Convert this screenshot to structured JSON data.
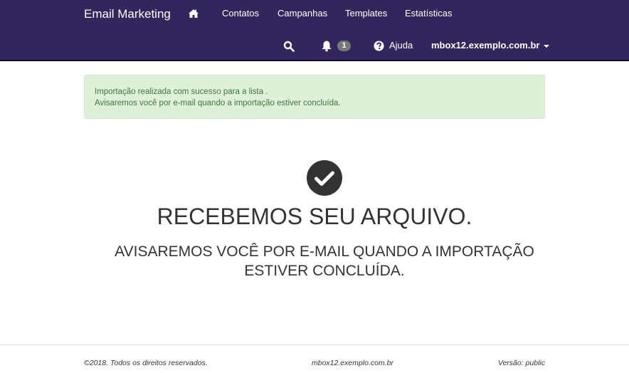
{
  "navbar": {
    "brand": "Email Marketing",
    "links": [
      "Contatos",
      "Campanhas",
      "Templates",
      "Estatísticas"
    ],
    "notification_count": "1",
    "help_label": "Ajuda",
    "user": "mbox12.exemplo.com.br"
  },
  "alert": {
    "line1": "Importação realizada com sucesso para a lista .",
    "line2": "Avisaremos você por e-mail quando a importação estiver concluída."
  },
  "main": {
    "title": "RECEBEMOS SEU ARQUIVO.",
    "subtitle": "AVISAREMOS VOCÊ POR E-MAIL QUANDO A IMPORTAÇÃO ESTIVER CONCLUÍDA."
  },
  "footer": {
    "copyright": "©2018. Todos os direitos reservados.",
    "host": "mbox12.exemplo.com.br",
    "version": "Versão: public"
  }
}
